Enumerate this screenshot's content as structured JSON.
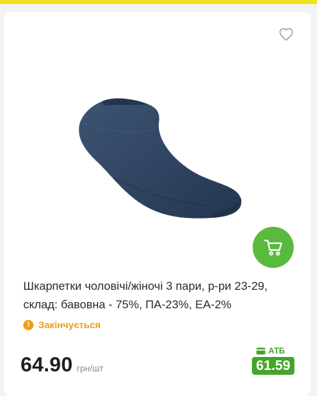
{
  "product": {
    "title": "Шкарпетки чоловічі/жіночі 3 пари, р-ри 23-29, склад: бавовна - 75%, ПА-23%, ЕА-2%",
    "availability": "Закінчується",
    "availability_icon": "!",
    "price": "64.90",
    "price_unit": "грн/шт",
    "card_price_label": "АТБ",
    "card_price": "61.59"
  },
  "colors": {
    "accent_yellow": "#f5e21f",
    "cart_green": "#5aba3d",
    "promo_green": "#43a52a",
    "warning_orange": "#f39c12"
  },
  "icons": {
    "favorite": "heart-outline-icon",
    "cart": "shopping-cart-icon",
    "availability": "exclamation-circle-icon",
    "atb_card": "wallet-card-icon"
  }
}
